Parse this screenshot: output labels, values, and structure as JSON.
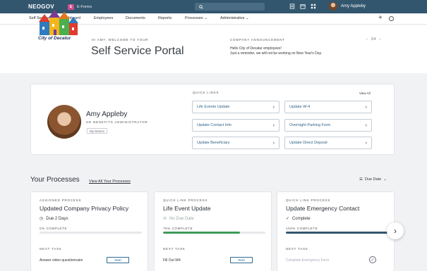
{
  "topbar": {
    "brand": "NEOGOV",
    "product_badge": "E",
    "product": "E-Forms",
    "user_name": "Amy Appleby"
  },
  "nav": {
    "items": [
      {
        "label": "Self Service"
      },
      {
        "label": "Dashboard"
      },
      {
        "label": "Employees"
      },
      {
        "label": "Documents"
      },
      {
        "label": "Reports"
      },
      {
        "label": "Processes"
      },
      {
        "label": "Administrative"
      }
    ]
  },
  "hero": {
    "logo_text": "City of Decatur",
    "welcome": "HI AMY, WELCOME TO YOUR",
    "title": "Self Service Portal",
    "announcement_label": "COMPANY ANNOUNCEMENT",
    "announcement_line1": "Hello City of Decatur employees!",
    "announcement_line2": "Just a reminder, we will not be working on New Year's Day.",
    "pager": "2/4"
  },
  "profile": {
    "name": "Amy Appleby",
    "role": "HR BENEFITS ADMINISTRATOR",
    "tag": "My Device"
  },
  "quick_links": {
    "title": "QUICK LINKS",
    "view_all": "View All",
    "items": [
      {
        "label": "Life Events Update"
      },
      {
        "label": "Update W-4"
      },
      {
        "label": "Update Contact Info"
      },
      {
        "label": "Overnight Parking Form"
      },
      {
        "label": "Update Beneficiary"
      },
      {
        "label": "Update Direct Deposit"
      }
    ]
  },
  "processes": {
    "title": "Your Processes",
    "view_all": "View All Your Processes",
    "sort": "Due Date",
    "cards": [
      {
        "type": "ASSIGNED PROCESS",
        "title": "Updated Company Privacy Policy",
        "status": "Due 2 Days",
        "progress_label": "0% COMPLETE",
        "progress": 0,
        "next_label": "NEXT TASK",
        "task": "Answer video questionnaire",
        "action": "Start"
      },
      {
        "type": "QUICK LINK PROCESS",
        "title": "Life Event Update",
        "status": "No Due Date",
        "progress_label": "75% COMPLETE",
        "progress": 75,
        "next_label": "NEXT TASK",
        "task": "Fill Out W4",
        "action": "Start"
      },
      {
        "type": "QUICK LINK PROCESS",
        "title": "Update Emergency Contact",
        "status": "Complete",
        "progress_label": "100% COMPLETE",
        "progress": 100,
        "next_label": "NEXT TASK",
        "task": "Complete Emergency Form"
      }
    ]
  },
  "colors": {
    "topbar": "#32566e",
    "progress_green": "#3f9a5a",
    "progress_blue": "#32566e",
    "link": "#31648a"
  }
}
